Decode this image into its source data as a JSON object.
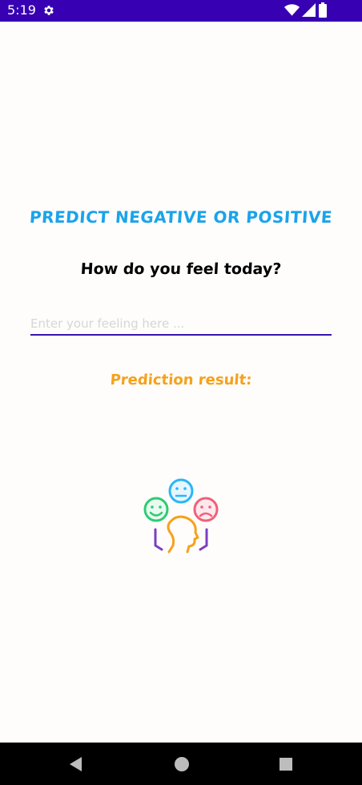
{
  "status_bar": {
    "time": "5:19",
    "background_color": "#3700b3",
    "icons": [
      "gear-icon",
      "wifi-icon",
      "signal-icon",
      "battery-icon"
    ]
  },
  "main": {
    "title": "PREDICT NEGATIVE OR POSITIVE",
    "question": "How do you feel today?",
    "input": {
      "placeholder": "Enter your feeling here ...",
      "value": ""
    },
    "result_label": "Prediction result:",
    "result_value": "",
    "illustration": "emotions-illustration",
    "colors": {
      "title": "#1aa3ec",
      "result_label": "#f6a11c",
      "input_underline": "#3a14b0",
      "happy_face": "#2ecc71",
      "neutral_face": "#29b6f6",
      "sad_face": "#f0607a",
      "head": "#f6a11c",
      "hands": "#7b3fc4"
    }
  },
  "nav_bar": {
    "buttons": [
      "back-icon",
      "home-icon",
      "recents-icon"
    ]
  }
}
